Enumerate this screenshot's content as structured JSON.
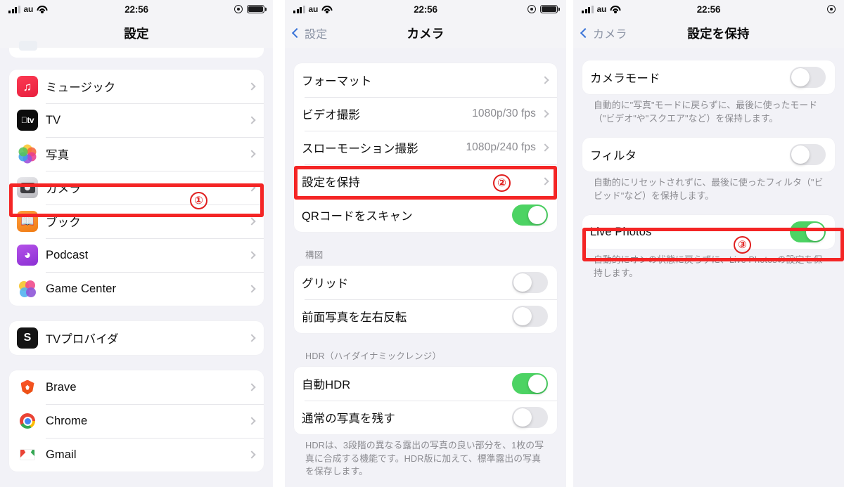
{
  "statusbar": {
    "carrier": "au",
    "time": "22:56",
    "icons": {
      "signal": "signal-bars-icon",
      "wifi": "wifi-icon",
      "lock": "rotation-lock-icon",
      "battery": "battery-icon"
    }
  },
  "panel1": {
    "title": "設定",
    "items": [
      {
        "label": "ミュージック",
        "icon": "music-app-icon"
      },
      {
        "label": "TV",
        "icon": "tv-app-icon"
      },
      {
        "label": "写真",
        "icon": "photos-app-icon"
      },
      {
        "label": "カメラ",
        "icon": "camera-app-icon"
      },
      {
        "label": "ブック",
        "icon": "books-app-icon"
      },
      {
        "label": "Podcast",
        "icon": "podcast-app-icon"
      },
      {
        "label": "Game Center",
        "icon": "game-center-app-icon"
      }
    ],
    "group2": [
      {
        "label": "TVプロバイダ",
        "icon": "tv-provider-app-icon"
      }
    ],
    "group3": [
      {
        "label": "Brave",
        "icon": "brave-app-icon"
      },
      {
        "label": "Chrome",
        "icon": "chrome-app-icon"
      },
      {
        "label": "Gmail",
        "icon": "gmail-app-icon"
      }
    ],
    "marker": "①"
  },
  "panel2": {
    "back_label": "設定",
    "title": "カメラ",
    "group1": [
      {
        "label": "フォーマット",
        "value": ""
      },
      {
        "label": "ビデオ撮影",
        "value": "1080p/30 fps"
      },
      {
        "label": "スローモーション撮影",
        "value": "1080p/240 fps"
      },
      {
        "label": "設定を保持",
        "value": ""
      }
    ],
    "qr_row": {
      "label": "QRコードをスキャン",
      "state": "on"
    },
    "composition_header": "構図",
    "composition_rows": [
      {
        "label": "グリッド",
        "state": "off"
      },
      {
        "label": "前面写真を左右反転",
        "state": "off"
      }
    ],
    "hdr_header": "HDR（ハイダイナミックレンジ）",
    "hdr_rows": [
      {
        "label": "自動HDR",
        "state": "on"
      },
      {
        "label": "通常の写真を残す",
        "state": "off"
      }
    ],
    "hdr_footer": "HDRは、3段階の異なる露出の写真の良い部分を、1枚の写真に合成する機能です。HDR版に加えて、標準露出の写真を保存します。",
    "marker": "②"
  },
  "panel3": {
    "back_label": "カメラ",
    "title": "設定を保持",
    "rows": [
      {
        "label": "カメラモード",
        "state": "off",
        "footer": "自動的に\"写真\"モードに戻らずに、最後に使ったモード（\"ビデオ\"や\"スクエア\"など）を保持します。"
      },
      {
        "label": "フィルタ",
        "state": "off",
        "footer": "自動的にリセットされずに、最後に使ったフィルタ（\"ビビッド\"など）を保持します。"
      },
      {
        "label": "Live Photos",
        "state": "on",
        "footer": "自動的にオンの状態に戻らずに、Live Photosの設定を保持します。"
      }
    ],
    "marker": "③"
  },
  "colors": {
    "highlight_red": "#f42525",
    "toggle_on_green": "#4cd363",
    "toggle_off_gray": "#e6e6ea",
    "tint_blue": "#3a74d8",
    "page_bg": "#f2f2f7"
  }
}
